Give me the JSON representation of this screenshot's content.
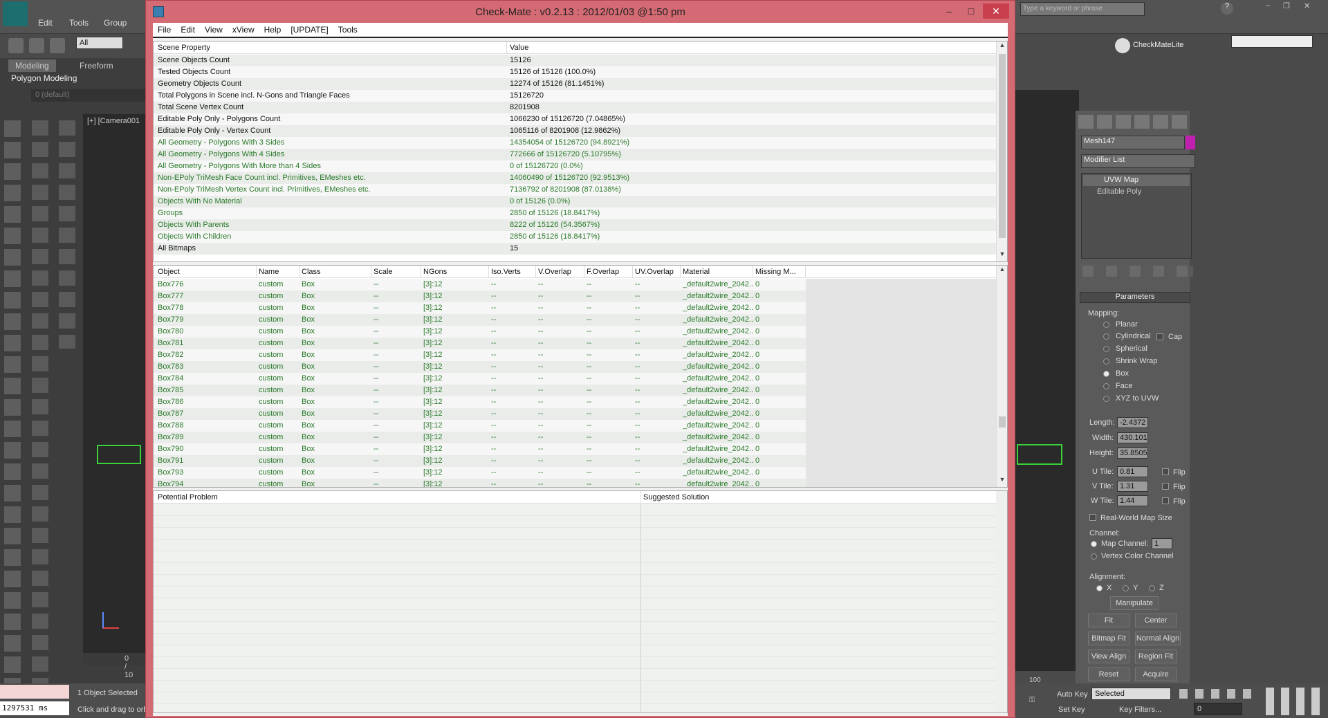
{
  "max": {
    "menus": [
      "Edit",
      "Tools",
      "Group"
    ],
    "filter_select": "All",
    "ribbon_tabs": [
      "Modeling",
      "Freeform"
    ],
    "ribbon_panel": "Polygon Modeling",
    "layer_label": "0 (default)",
    "viewport_label": "[+] [Camera001",
    "timeslider": "0 / 10",
    "search_placeholder": "Type a keyword or phrase",
    "toolbar_right_label": "CheckMateLite",
    "status_selected": "1 Object Selected",
    "status_hint": "Click and drag to orb",
    "status_time": "1297531 ms",
    "autokey": "Auto Key",
    "setkey": "Set Key",
    "selected_select": "Selected",
    "key_filters": "Key Filters...",
    "frame": "0",
    "track_tick": "100"
  },
  "cmd": {
    "object_name": "Mesh147",
    "modifier_list": "Modifier List",
    "stack": [
      "UVW Map",
      "Editable Poly"
    ],
    "rollout": "Parameters",
    "mapping_label": "Mapping:",
    "mapping_options": [
      "Planar",
      "Cylindrical",
      "Spherical",
      "Shrink Wrap",
      "Box",
      "Face",
      "XYZ to UVW"
    ],
    "cap_label": "Cap",
    "length_label": "Length:",
    "length": "-2.4372",
    "width_label": "Width:",
    "width": "430.101",
    "height_label": "Height:",
    "height": "35.8505",
    "utile_label": "U Tile:",
    "utile": "0.81",
    "vtile_label": "V Tile:",
    "vtile": "1.31",
    "wtile_label": "W Tile:",
    "wtile": "1.44",
    "flip": "Flip",
    "realworld": "Real-World Map Size",
    "channel_label": "Channel:",
    "map_channel": "Map Channel:",
    "map_channel_value": "1",
    "vertex_color": "Vertex Color Channel",
    "alignment_label": "Alignment:",
    "axes": [
      "X",
      "Y",
      "Z"
    ],
    "buttons": {
      "manipulate": "Manipulate",
      "fit": "Fit",
      "center": "Center",
      "bitmap_fit": "Bitmap Fit",
      "normal_align": "Normal Align",
      "view_align": "View Align",
      "region_fit": "Region Fit",
      "reset": "Reset",
      "acquire": "Acquire"
    }
  },
  "dialog": {
    "title": "Check-Mate : v0.2.13 : 2012/01/03 @1:50 pm",
    "menu": [
      "File",
      "Edit",
      "View",
      "xView",
      "Help",
      "[UPDATE]",
      "Tools"
    ],
    "scene": {
      "headers": [
        "Scene Property",
        "Value"
      ],
      "rows": [
        {
          "p": "Scene Objects Count",
          "v": "15126",
          "c": "#111"
        },
        {
          "p": "Tested Objects Count",
          "v": "15126 of 15126 (100.0%)",
          "c": "#111"
        },
        {
          "p": "Geometry Objects Count",
          "v": "12274 of 15126 (81.1451%)",
          "c": "#111"
        },
        {
          "p": "Total Polygons in Scene incl. N-Gons and Triangle Faces",
          "v": "15126720",
          "c": "#111"
        },
        {
          "p": "Total Scene Vertex Count",
          "v": "8201908",
          "c": "#111"
        },
        {
          "p": "Editable Poly Only - Polygons Count",
          "v": "1066230 of 15126720 (7.04865%)",
          "c": "#111"
        },
        {
          "p": "Editable Poly Only - Vertex Count",
          "v": "1065116 of 8201908 (12.9862%)",
          "c": "#111"
        },
        {
          "p": "All Geometry - Polygons With 3 Sides",
          "v": "14354054 of 15126720 (94.8921%)",
          "c": "#2a7a2a"
        },
        {
          "p": "All Geometry - Polygons With 4 Sides",
          "v": "772666 of 15126720 (5.10795%)",
          "c": "#2a7a2a"
        },
        {
          "p": "All Geometry - Polygons With More than 4 Sides",
          "v": "0 of 15126720 (0.0%)",
          "c": "#2a7a2a"
        },
        {
          "p": "Non-EPoly TriMesh Face Count incl. Primitives, EMeshes etc.",
          "v": "14060490 of 15126720 (92.9513%)",
          "c": "#2a7a2a"
        },
        {
          "p": "Non-EPoly TriMesh Vertex Count incl. Primitives, EMeshes etc.",
          "v": "7136792 of 8201908 (87.0138%)",
          "c": "#2a7a2a"
        },
        {
          "p": "Objects With No Material",
          "v": "0 of 15126 (0.0%)",
          "c": "#2a7a2a"
        },
        {
          "p": "Groups",
          "v": "2850 of 15126 (18.8417%)",
          "c": "#2a7a2a"
        },
        {
          "p": "Objects With Parents",
          "v": "8222 of 15126 (54.3567%)",
          "c": "#2a7a2a"
        },
        {
          "p": "Objects With Children",
          "v": "2850 of 15126 (18.8417%)",
          "c": "#2a7a2a"
        },
        {
          "p": "All Bitmaps",
          "v": "15",
          "c": "#111"
        }
      ]
    },
    "objects": {
      "headers": [
        "Object",
        "Name",
        "Class",
        "Scale",
        "NGons",
        "Iso.Verts",
        "V.Overlap",
        "F.Overlap",
        "UV.Overlap",
        "Material",
        "Missing M..."
      ],
      "rows": [
        [
          "Box776",
          "custom",
          "Box",
          "--",
          "[3]:12",
          "--",
          "--",
          "--",
          "--",
          "_default2wire_2042...",
          "0"
        ],
        [
          "Box777",
          "custom",
          "Box",
          "--",
          "[3]:12",
          "--",
          "--",
          "--",
          "--",
          "_default2wire_2042...",
          "0"
        ],
        [
          "Box778",
          "custom",
          "Box",
          "--",
          "[3]:12",
          "--",
          "--",
          "--",
          "--",
          "_default2wire_2042...",
          "0"
        ],
        [
          "Box779",
          "custom",
          "Box",
          "--",
          "[3]:12",
          "--",
          "--",
          "--",
          "--",
          "_default2wire_2042...",
          "0"
        ],
        [
          "Box780",
          "custom",
          "Box",
          "--",
          "[3]:12",
          "--",
          "--",
          "--",
          "--",
          "_default2wire_2042...",
          "0"
        ],
        [
          "Box781",
          "custom",
          "Box",
          "--",
          "[3]:12",
          "--",
          "--",
          "--",
          "--",
          "_default2wire_2042...",
          "0"
        ],
        [
          "Box782",
          "custom",
          "Box",
          "--",
          "[3]:12",
          "--",
          "--",
          "--",
          "--",
          "_default2wire_2042...",
          "0"
        ],
        [
          "Box783",
          "custom",
          "Box",
          "--",
          "[3]:12",
          "--",
          "--",
          "--",
          "--",
          "_default2wire_2042...",
          "0"
        ],
        [
          "Box784",
          "custom",
          "Box",
          "--",
          "[3]:12",
          "--",
          "--",
          "--",
          "--",
          "_default2wire_2042...",
          "0"
        ],
        [
          "Box785",
          "custom",
          "Box",
          "--",
          "[3]:12",
          "--",
          "--",
          "--",
          "--",
          "_default2wire_2042...",
          "0"
        ],
        [
          "Box786",
          "custom",
          "Box",
          "--",
          "[3]:12",
          "--",
          "--",
          "--",
          "--",
          "_default2wire_2042...",
          "0"
        ],
        [
          "Box787",
          "custom",
          "Box",
          "--",
          "[3]:12",
          "--",
          "--",
          "--",
          "--",
          "_default2wire_2042...",
          "0"
        ],
        [
          "Box788",
          "custom",
          "Box",
          "--",
          "[3]:12",
          "--",
          "--",
          "--",
          "--",
          "_default2wire_2042...",
          "0"
        ],
        [
          "Box789",
          "custom",
          "Box",
          "--",
          "[3]:12",
          "--",
          "--",
          "--",
          "--",
          "_default2wire_2042...",
          "0"
        ],
        [
          "Box790",
          "custom",
          "Box",
          "--",
          "[3]:12",
          "--",
          "--",
          "--",
          "--",
          "_default2wire_2042...",
          "0"
        ],
        [
          "Box791",
          "custom",
          "Box",
          "--",
          "[3]:12",
          "--",
          "--",
          "--",
          "--",
          "_default2wire_2042...",
          "0"
        ],
        [
          "Box793",
          "custom",
          "Box",
          "--",
          "[3]:12",
          "--",
          "--",
          "--",
          "--",
          "_default2wire_2042...",
          "0"
        ],
        [
          "Box794",
          "custom",
          "Box",
          "--",
          "[3]:12",
          "--",
          "--",
          "--",
          "--",
          "_default2wire_2042...",
          "0"
        ]
      ]
    },
    "problems": {
      "headers": [
        "Potential Problem",
        "Suggested Solution"
      ]
    }
  }
}
